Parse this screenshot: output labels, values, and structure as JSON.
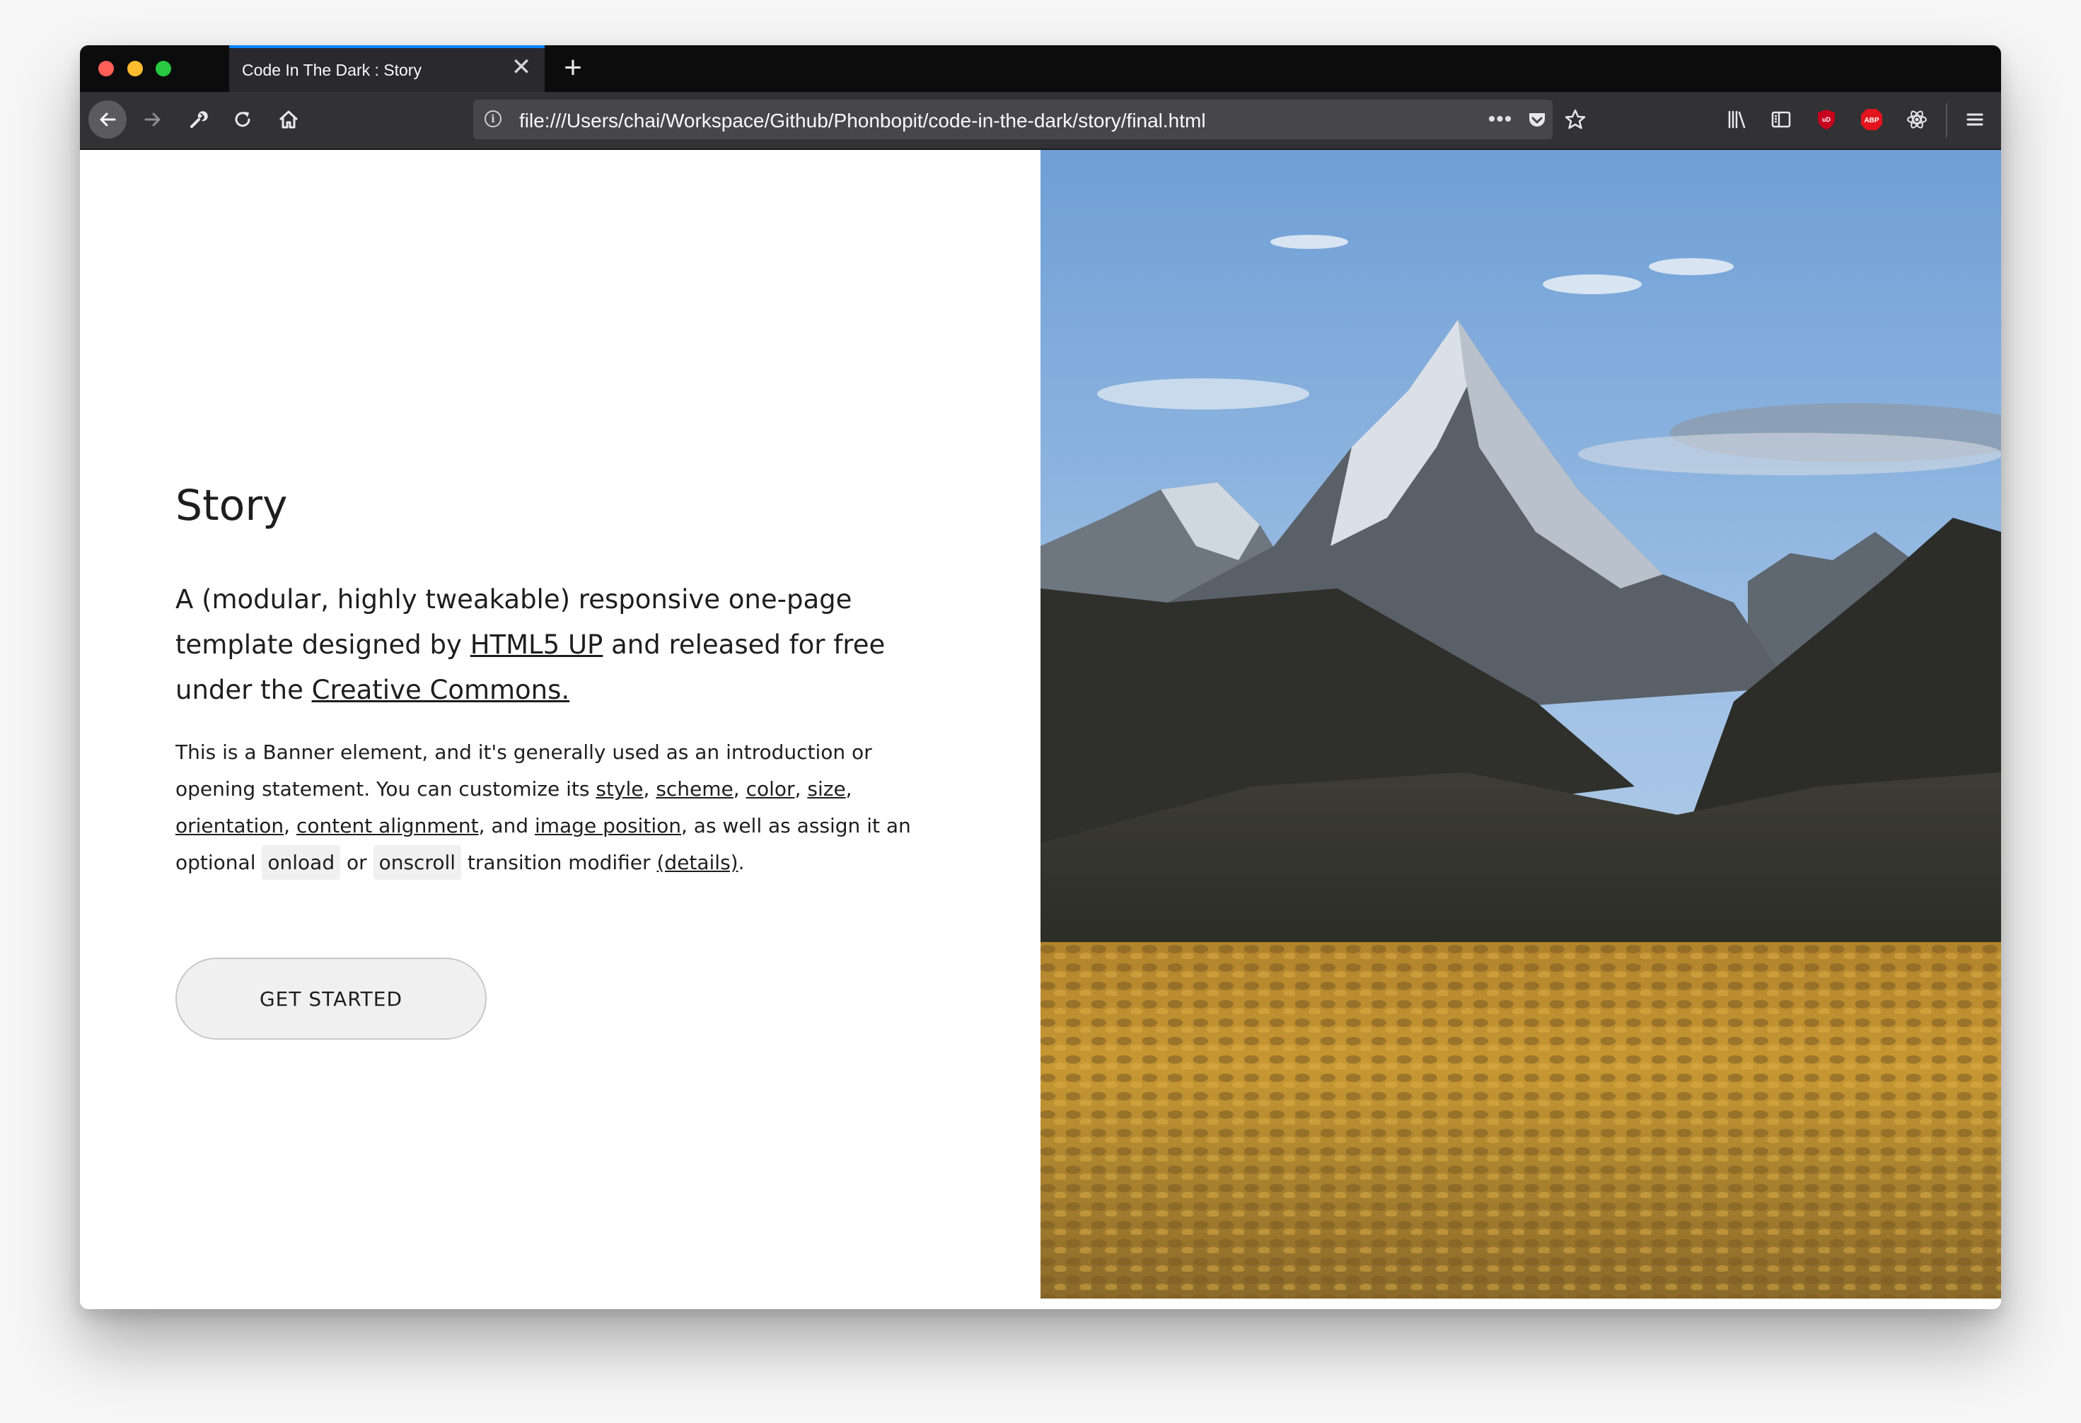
{
  "browser": {
    "tab_title": "Code In The Dark : Story",
    "tab_close_glyph": "✕",
    "new_tab_glyph": "+",
    "url": "file:///Users/chai/Workspace/Github/Phonbopit/code-in-the-dark/story/final.html",
    "url_more_glyph": "•••",
    "abp_label": "ABP",
    "ublock_label": "uD",
    "accent": "#0a84ff"
  },
  "page": {
    "title": "Story",
    "lead": {
      "t1": "A (modular, highly tweakable) responsive one-page template designed by ",
      "link1": "HTML5 UP",
      "t2": " and released for free under the ",
      "link2": "Creative Commons.",
      "t3": ""
    },
    "body": {
      "t1": "This is a Banner element, and it's generally used as an introduction or opening statement. You can customize its ",
      "style": "style",
      "c1": ", ",
      "scheme": "scheme",
      "c2": ", ",
      "color": "color",
      "c3": ", ",
      "size": "size",
      "c4": ", ",
      "orientation": "orientation",
      "c5": ", ",
      "content_alignment": "content alignment",
      "t2": ", and ",
      "image_position": "image position",
      "t3": ", as well as assign it an optional ",
      "onload": "onload",
      "t4": " or ",
      "onscroll": "onscroll",
      "t5": " transition modifier ",
      "details": "(details)",
      "t6": "."
    },
    "button_label": "GET STARTED"
  },
  "icons": {
    "back": "arrow-left-icon",
    "forward": "arrow-right-icon",
    "wrench": "wrench-icon",
    "reload": "reload-icon",
    "home": "home-icon",
    "info": "info-icon",
    "pocket": "pocket-icon",
    "star": "star-icon",
    "library": "library-icon",
    "sidebar": "sidebar-icon",
    "ublock": "ublock-icon",
    "abp": "adblock-plus-icon",
    "react": "react-devtools-icon",
    "menu": "hamburger-menu-icon"
  }
}
